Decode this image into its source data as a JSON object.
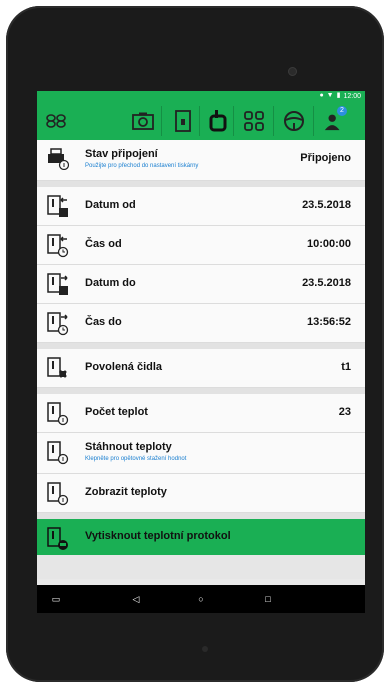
{
  "statusbar": {
    "time": "12:00"
  },
  "toolbar": {
    "icons": [
      "app-logo-icon",
      "camera-icon",
      "document-icon",
      "device-icon",
      "qr-code-icon",
      "steering-wheel-icon",
      "driver-icon"
    ],
    "driver_badge": "2"
  },
  "rows": {
    "connection": {
      "title": "Stav připojení",
      "subtitle": "Použijte pro přechod do nastavení tiskárny",
      "value": "Připojeno"
    },
    "date_from": {
      "title": "Datum od",
      "value": "23.5.2018"
    },
    "time_from": {
      "title": "Čas od",
      "value": "10:00:00"
    },
    "date_to": {
      "title": "Datum do",
      "value": "23.5.2018"
    },
    "time_to": {
      "title": "Čas do",
      "value": "13:56:52"
    },
    "sensors": {
      "title": "Povolená čidla",
      "value": "t1"
    },
    "count": {
      "title": "Počet teplot",
      "value": "23"
    },
    "download": {
      "title": "Stáhnout teploty",
      "subtitle": "Klepněte pro opětovné stažení hodnot"
    },
    "show": {
      "title": "Zobrazit teploty"
    },
    "print": {
      "title": "Vytisknout teplotní protokol"
    }
  },
  "colors": {
    "accent": "#1aaf54",
    "link": "#1a7fd0"
  }
}
